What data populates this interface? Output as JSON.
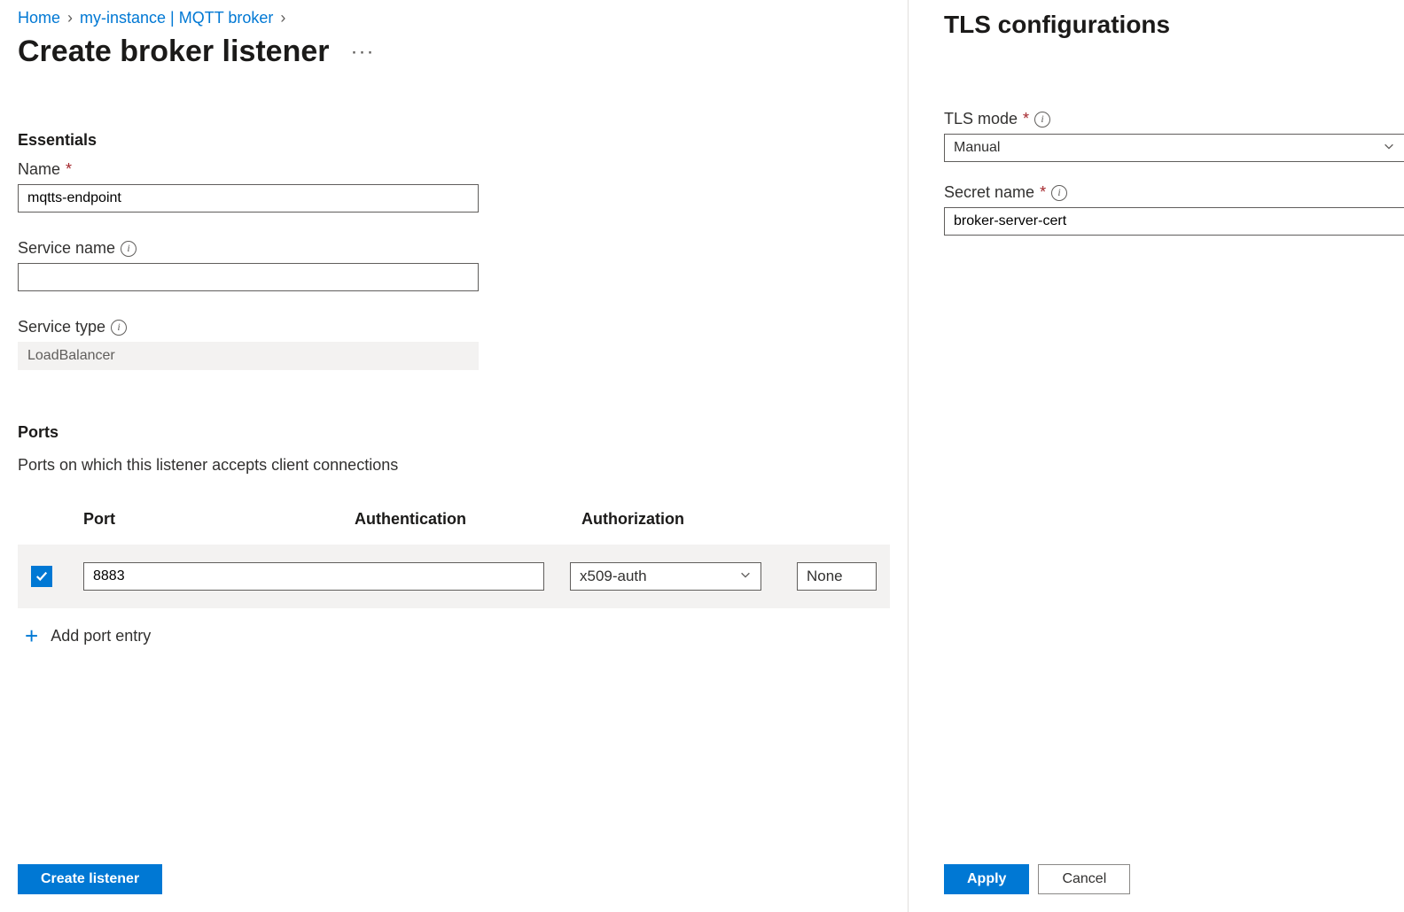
{
  "breadcrumb": {
    "home": "Home",
    "instance": "my-instance | MQTT broker"
  },
  "page_title": "Create broker listener",
  "essentials": {
    "heading": "Essentials",
    "name_label": "Name",
    "name_value": "mqtts-endpoint",
    "service_name_label": "Service name",
    "service_name_value": "",
    "service_type_label": "Service type",
    "service_type_value": "LoadBalancer"
  },
  "ports": {
    "heading": "Ports",
    "description": "Ports on which this listener accepts client connections",
    "columns": {
      "port": "Port",
      "auth": "Authentication",
      "authz": "Authorization"
    },
    "row": {
      "port": "8883",
      "auth": "x509-auth",
      "authz": "None"
    },
    "add_entry": "Add port entry"
  },
  "footer": {
    "create": "Create listener"
  },
  "sidepanel": {
    "title": "TLS configurations",
    "tls_mode_label": "TLS mode",
    "tls_mode_value": "Manual",
    "secret_name_label": "Secret name",
    "secret_name_value": "broker-server-cert",
    "apply": "Apply",
    "cancel": "Cancel"
  }
}
